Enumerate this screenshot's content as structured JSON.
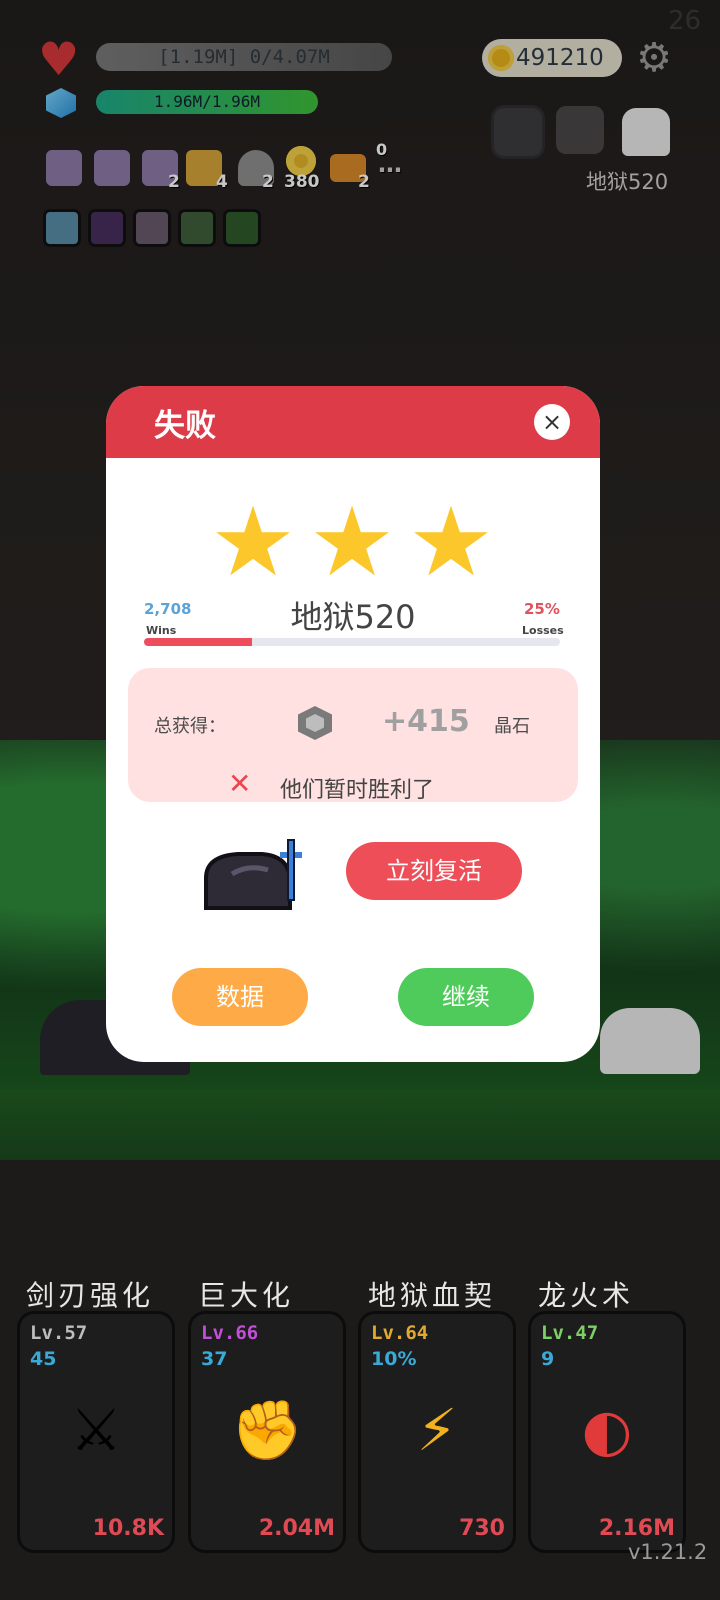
{
  "hud": {
    "hp_text": "[1.19M] 0/4.07M",
    "mp_text": "1.96M/1.96M",
    "coins": "491210",
    "fps": "26",
    "location": "地狱520"
  },
  "inventory": [
    {
      "name": "scroll-1",
      "count": ""
    },
    {
      "name": "scroll-2",
      "count": ""
    },
    {
      "name": "scroll-3",
      "count": "2"
    },
    {
      "name": "map",
      "count": "4"
    },
    {
      "name": "knight-helmet",
      "count": "2"
    },
    {
      "name": "sunflower",
      "count": "380"
    },
    {
      "name": "chest",
      "count": "2"
    },
    {
      "name": "more",
      "count": "0"
    }
  ],
  "dialog": {
    "title": "失败",
    "close": "×",
    "stars": 3,
    "wins_value": "2,708",
    "wins_label": "Wins",
    "losses_value": "25%",
    "losses_label": "Losses",
    "stage": "地狱520",
    "progress_fraction": 0.26,
    "reward_label": "总获得：",
    "reward_amount": "+415",
    "reward_unit": "晶石",
    "fail_message": "他们暂时胜利了",
    "revive_button": "立刻复活",
    "stats_button": "数据",
    "continue_button": "继续"
  },
  "skills": [
    {
      "name": "剑刃强化",
      "level": "Lv.57",
      "value": "45",
      "cost": "10.8K",
      "level_color": "#bdbdbd",
      "icon": "crossed-swords-icon"
    },
    {
      "name": "巨大化",
      "level": "Lv.66",
      "value": "37",
      "cost": "2.04M",
      "level_color": "#c14fd8",
      "icon": "fist-icon"
    },
    {
      "name": "地狱血契",
      "level": "Lv.64",
      "value": "10%",
      "cost": "730",
      "level_color": "#e3a92e",
      "icon": "lightning-icon"
    },
    {
      "name": "龙火术",
      "level": "Lv.47",
      "value": "9",
      "cost": "2.16M",
      "level_color": "#7fcf67",
      "icon": "watermelon-icon"
    }
  ],
  "version": "v1.21.2",
  "colors": {
    "dialog_header": "#de3b48",
    "revive": "#ee4e58",
    "stats": "#fdaa47",
    "continue": "#4ecb5a",
    "reward_bg": "#ffe1e1"
  }
}
